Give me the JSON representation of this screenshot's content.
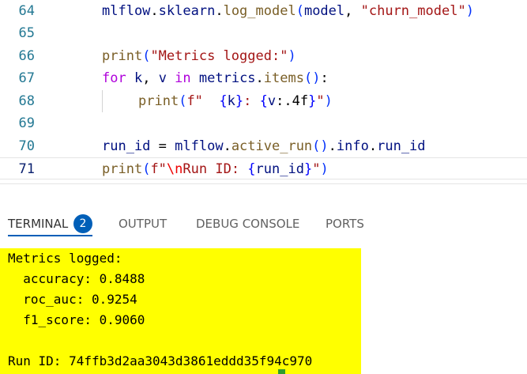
{
  "editor": {
    "lines": [
      {
        "num": "64",
        "tokens": {
          "a": "mlflow",
          "b": ".",
          "c": "sklearn",
          "d": ".",
          "e": "log_model",
          "f": "(",
          "g": "model",
          "h": ", ",
          "i": "\"churn_model\"",
          "j": ")"
        }
      },
      {
        "num": "65"
      },
      {
        "num": "66",
        "tokens": {
          "a": "print",
          "b": "(",
          "c": "\"Metrics logged:\"",
          "d": ")"
        }
      },
      {
        "num": "67",
        "tokens": {
          "a": "for",
          "b": " k",
          "c": ", ",
          "d": "v",
          "e": " in ",
          "f": "metrics",
          "g": ".",
          "h": "items",
          "i": "()",
          "j": ":"
        }
      },
      {
        "num": "68",
        "tokens": {
          "a": "print",
          "b": "(",
          "c": "f\"  ",
          "d": "{",
          "e": "k",
          "f": "}",
          "g": ": ",
          "h": "{",
          "i": "v",
          "j": ":.4f",
          "k": "}",
          "l": "\"",
          "m": ")"
        }
      },
      {
        "num": "69"
      },
      {
        "num": "70",
        "tokens": {
          "a": "run_id",
          "b": " = ",
          "c": "mlflow",
          "d": ".",
          "e": "active_run",
          "f": "()",
          "g": ".",
          "h": "info",
          "i": ".",
          "j": "run_id"
        }
      },
      {
        "num": "71",
        "tokens": {
          "a": "print",
          "b": "(",
          "c": "f\"",
          "d": "\\n",
          "e": "Run ID: ",
          "f": "{",
          "g": "run_id",
          "h": "}",
          "i": "\"",
          "j": ")"
        }
      }
    ]
  },
  "panel": {
    "tabs": [
      {
        "label": "TERMINAL",
        "active": true,
        "badge": "2"
      },
      {
        "label": "OUTPUT"
      },
      {
        "label": "DEBUG CONSOLE"
      },
      {
        "label": "PORTS"
      }
    ]
  },
  "terminal": {
    "lines": [
      "Metrics logged:",
      "  accuracy: 0.8488",
      "  roc_auc: 0.9254",
      "  f1_score: 0.9060",
      "",
      "Run ID: 74ffb3d2aa3043d3861eddd35f94c970"
    ]
  },
  "colors": {
    "terminal_highlight": "#ffff00",
    "accent": "#005fb8",
    "line_number": "#237893"
  }
}
